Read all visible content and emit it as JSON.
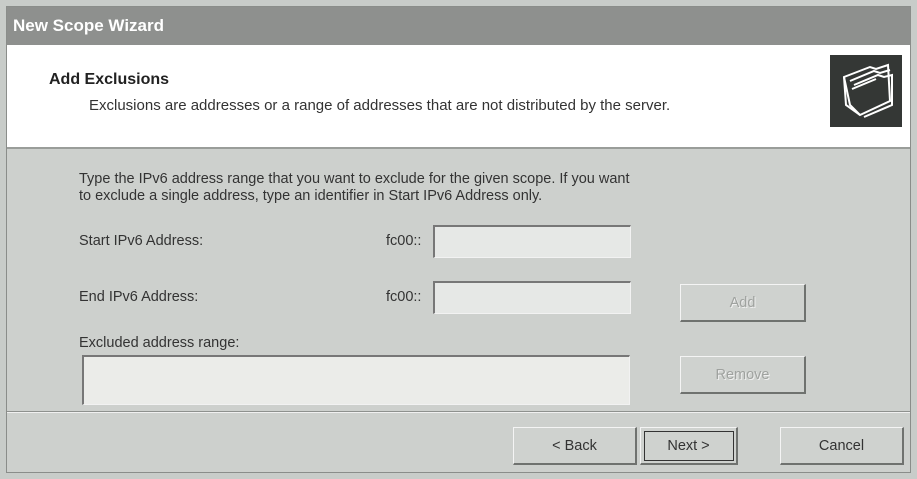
{
  "window": {
    "title": "New Scope Wizard"
  },
  "header": {
    "title": "Add Exclusions",
    "subtitle": "Exclusions are addresses or a range of addresses that are not distributed by the server.",
    "icon": "folders-icon"
  },
  "body": {
    "instructions_line1": "Type the IPv6 address range that you want to exclude for the given scope. If you want",
    "instructions_line2": "to exclude a single address, type an identifier in Start IPv6 Address only.",
    "start_label": "Start IPv6 Address:",
    "start_prefix": "fc00::",
    "start_value": "",
    "end_label": "End IPv6 Address:",
    "end_prefix": "fc00::",
    "end_value": "",
    "add_label": "Add",
    "excluded_label": "Excluded address range:",
    "remove_label": "Remove"
  },
  "footer": {
    "back_label": "< Back",
    "next_label": "Next >",
    "cancel_label": "Cancel"
  }
}
